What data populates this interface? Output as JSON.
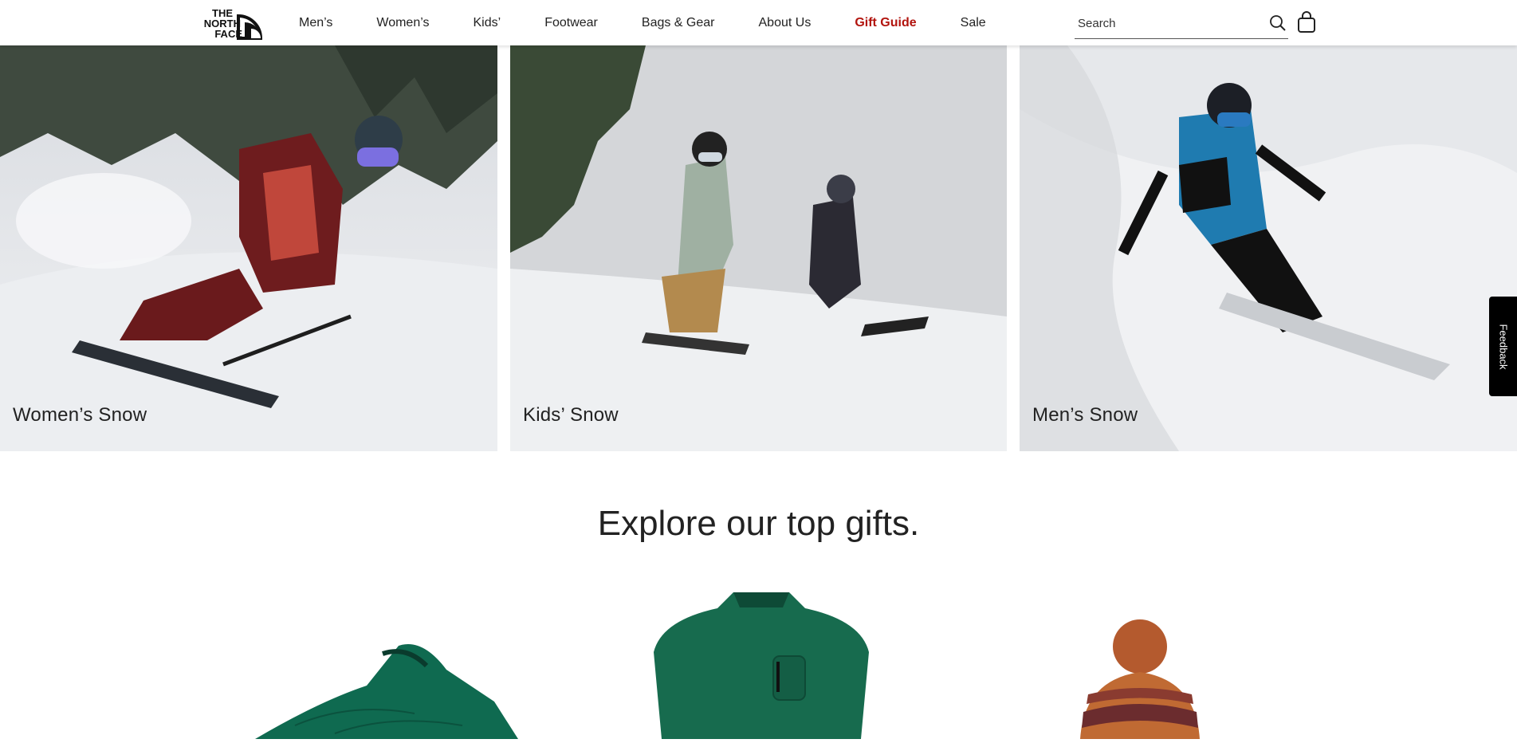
{
  "brand": {
    "logo_text_line1": "THE",
    "logo_text_line2": "NORTH",
    "logo_text_line3": "FACE"
  },
  "nav": {
    "items": [
      {
        "label": "Men’s"
      },
      {
        "label": "Women’s"
      },
      {
        "label": "Kids’"
      },
      {
        "label": "Footwear"
      },
      {
        "label": "Bags & Gear"
      },
      {
        "label": "About Us"
      },
      {
        "label": "Gift Guide"
      },
      {
        "label": "Sale"
      }
    ]
  },
  "search": {
    "placeholder": "Search",
    "value": ""
  },
  "icons": {
    "search": "search-icon",
    "cart": "shopping-bag-icon"
  },
  "colors": {
    "accent": "#b2140e",
    "feedback_bg": "#000000"
  },
  "tiles": [
    {
      "label": "Women’s Snow"
    },
    {
      "label": "Kids’ Snow"
    },
    {
      "label": "Men’s Snow"
    }
  ],
  "gifts_section": {
    "title": "Explore our top gifts."
  },
  "feedback": {
    "label": "Feedback"
  }
}
